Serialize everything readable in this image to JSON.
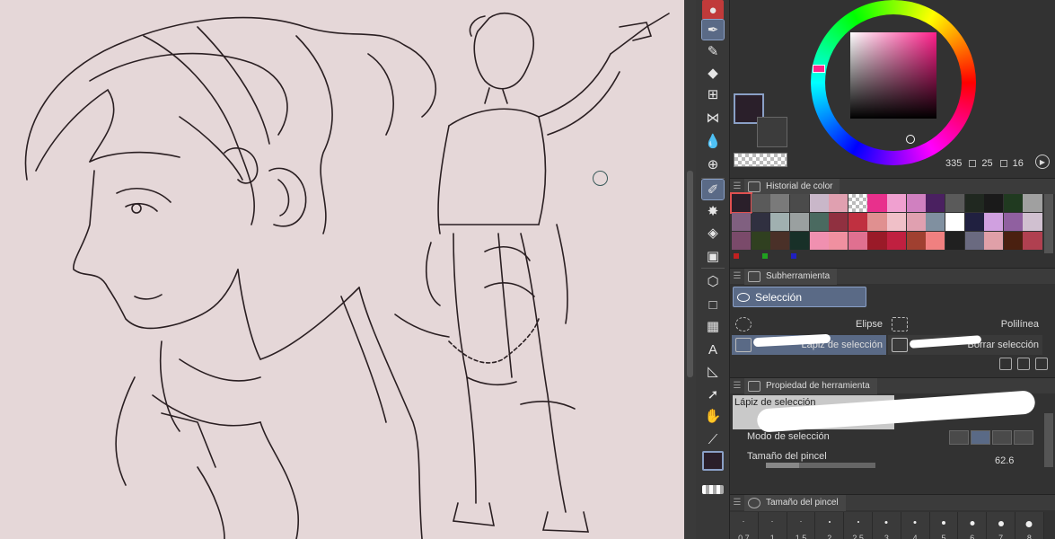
{
  "colors": {
    "main_color": "#2a1f2a",
    "sub_color": "#3c3c3c",
    "canvas_bg": "#e5d7d8",
    "accent": "#5a6a86"
  },
  "color_wheel": {
    "hue": "335",
    "saturation": "25",
    "value": "16"
  },
  "color_history": {
    "title": "Historial de color",
    "rows": [
      [
        "#2a1f2a",
        "#5a5a5a",
        "#7a7a7a",
        "#4b4b4b",
        "#c9b7c9",
        "#e0a0b0",
        "transparent",
        "#e8308c",
        "#f0a0d0",
        "#d080c0",
        "#4a2060",
        "#5a5a5a",
        "#202820",
        "#1a1a1a",
        "#203a20",
        "#a0a0a0"
      ],
      [
        "#806080",
        "#303040",
        "#a0b0b0",
        "#9aa0a0",
        "#4a6a60",
        "#903040",
        "#c03040",
        "#e09090",
        "#f0c0c8",
        "#e0a0b0",
        "#8090a0",
        "#ffffff",
        "#202040",
        "#d0a0e0",
        "#9060a0",
        "#d0c0d0"
      ],
      [
        "#7a4a6a",
        "#304020",
        "#4a3028",
        "#183028",
        "#f090b0",
        "#f090a0",
        "#e07090",
        "#9a1a28",
        "#c02040",
        "#a04030",
        "#f08080",
        "#202020",
        "#6a6a80",
        "#e0a0a8",
        "#4a2010",
        "#b04050"
      ]
    ],
    "marks": [
      "#c02020",
      "#20a020",
      "#2020c0"
    ]
  },
  "subtool": {
    "panel_title": "Subherramienta",
    "group": "Selección",
    "items": [
      {
        "label": "Elipse"
      },
      {
        "label": "Polilínea"
      },
      {
        "label": "Lápiz de selección"
      },
      {
        "label": "Borrar selección"
      }
    ]
  },
  "tool_property": {
    "panel_title": "Propiedad de herramienta",
    "tool_name": "Lápiz de selección",
    "mode_label": "Modo de selección",
    "size_label": "Tamaño del pincel",
    "size_value": "62.6",
    "size_fraction": 0.3
  },
  "brush_size": {
    "panel_title": "Tamaño del pincel",
    "sizes": [
      {
        "label": "0.7",
        "d": 1
      },
      {
        "label": "1",
        "d": 1
      },
      {
        "label": "1.5",
        "d": 1
      },
      {
        "label": "2",
        "d": 2
      },
      {
        "label": "2.5",
        "d": 2
      },
      {
        "label": "3",
        "d": 3
      },
      {
        "label": "4",
        "d": 3
      },
      {
        "label": "5",
        "d": 4
      },
      {
        "label": "6",
        "d": 5
      },
      {
        "label": "7",
        "d": 6
      },
      {
        "label": "8",
        "d": 7
      }
    ]
  }
}
